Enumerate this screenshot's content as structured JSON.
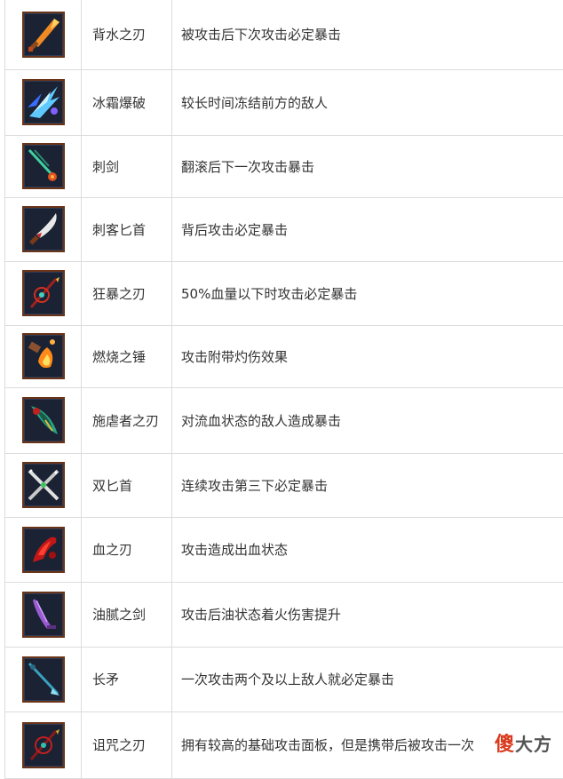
{
  "rows": [
    {
      "name": "背水之刃",
      "desc": "被攻击后下次攻击必定暴击",
      "icon": "orange-blade-icon"
    },
    {
      "name": "冰霜爆破",
      "desc": "较长时间冻结前方的敌人",
      "icon": "ice-blast-icon"
    },
    {
      "name": "刺剑",
      "desc": "翻滚后下一次攻击暴击",
      "icon": "rapier-icon"
    },
    {
      "name": "刺客匕首",
      "desc": "背后攻击必定暴击",
      "icon": "assassin-dagger-icon"
    },
    {
      "name": "狂暴之刃",
      "desc": "50%血量以下时攻击必定暴击",
      "icon": "berserk-blade-icon"
    },
    {
      "name": "燃烧之锤",
      "desc": "攻击附带灼伤效果",
      "icon": "burning-hammer-icon"
    },
    {
      "name": "施虐者之刃",
      "desc": "对流血状态的敌人造成暴击",
      "icon": "sadist-blade-icon"
    },
    {
      "name": "双匕首",
      "desc": "连续攻击第三下必定暴击",
      "icon": "twin-daggers-icon"
    },
    {
      "name": "血之刃",
      "desc": "攻击造成出血状态",
      "icon": "blood-blade-icon"
    },
    {
      "name": "油腻之剑",
      "desc": "攻击后油状态着火伤害提升",
      "icon": "oiled-sword-icon"
    },
    {
      "name": "长矛",
      "desc": "一次攻击两个及以上敌人就必定暴击",
      "icon": "spear-icon"
    },
    {
      "name": "诅咒之刃",
      "desc": "拥有较高的基础攻击面板，但是携带后被攻击一次",
      "icon": "cursed-blade-icon"
    }
  ],
  "watermark": {
    "part1": "傻",
    "part2": "大方"
  },
  "colors": {
    "border": "#dcdcdc",
    "icon_frame": "#6a3418",
    "icon_bg": "#1a2233",
    "text": "#333333"
  }
}
